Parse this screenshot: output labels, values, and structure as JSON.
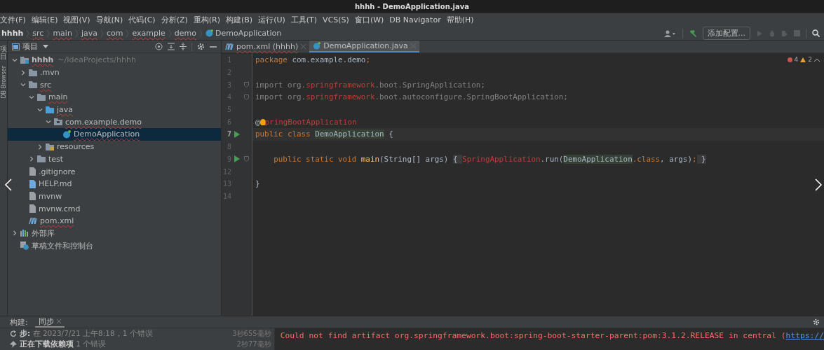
{
  "window": {
    "title": "hhhh - DemoApplication.java"
  },
  "menu": [
    "文件(F)",
    "编辑(E)",
    "视图(V)",
    "导航(N)",
    "代码(C)",
    "分析(Z)",
    "重构(R)",
    "构建(B)",
    "运行(U)",
    "工具(T)",
    "VCS(S)",
    "窗口(W)",
    "DB Navigator",
    "帮助(H)"
  ],
  "breadcrumbs": [
    {
      "label": "hhhh",
      "kind": "root",
      "error": false
    },
    {
      "label": "src",
      "kind": "plain",
      "error": true
    },
    {
      "label": "main",
      "kind": "plain",
      "error": true
    },
    {
      "label": "java",
      "kind": "plain",
      "error": true
    },
    {
      "label": "com",
      "kind": "plain",
      "error": true
    },
    {
      "label": "example",
      "kind": "plain",
      "error": true
    },
    {
      "label": "demo",
      "kind": "plain",
      "error": true
    },
    {
      "label": "DemoApplication",
      "kind": "class",
      "error": false
    }
  ],
  "toolbar": {
    "config_button": "添加配置...",
    "run_disabled": true
  },
  "side_stripe": {
    "project_tab": "项目",
    "db_tab": "DB Browser"
  },
  "project_panel": {
    "title": "项目",
    "tree": [
      {
        "label": "hhhh",
        "path": "~/IdeaProjects/hhhh",
        "kind": "module",
        "expanded": true,
        "selected": false,
        "error": true,
        "children": [
          {
            "label": ".mvn",
            "kind": "folder",
            "expanded": false,
            "selected": false,
            "error": false
          },
          {
            "label": "src",
            "kind": "folder",
            "expanded": true,
            "selected": false,
            "error": true,
            "children": [
              {
                "label": "main",
                "kind": "folder",
                "expanded": true,
                "selected": false,
                "error": true,
                "children": [
                  {
                    "label": "java",
                    "kind": "source",
                    "expanded": true,
                    "selected": false,
                    "error": true,
                    "children": [
                      {
                        "label": "com.example.demo",
                        "kind": "package",
                        "expanded": true,
                        "selected": false,
                        "error": true,
                        "children": [
                          {
                            "label": "DemoApplication",
                            "kind": "class",
                            "selected": true,
                            "error": true
                          }
                        ]
                      }
                    ]
                  },
                  {
                    "label": "resources",
                    "kind": "resources",
                    "expanded": false,
                    "selected": false,
                    "error": false
                  }
                ]
              },
              {
                "label": "test",
                "kind": "folder",
                "expanded": false,
                "selected": false,
                "error": false
              }
            ]
          },
          {
            "label": ".gitignore",
            "kind": "file",
            "selected": false,
            "error": false
          },
          {
            "label": "HELP.md",
            "kind": "markdown",
            "selected": false,
            "error": false
          },
          {
            "label": "mvnw",
            "kind": "script",
            "selected": false,
            "error": false
          },
          {
            "label": "mvnw.cmd",
            "kind": "file",
            "selected": false,
            "error": false
          },
          {
            "label": "pom.xml",
            "kind": "maven",
            "selected": false,
            "error": true
          }
        ]
      },
      {
        "label": "外部库",
        "kind": "library",
        "expanded": false,
        "selected": false,
        "error": false
      },
      {
        "label": "草稿文件和控制台",
        "kind": "scratch",
        "selected": false,
        "error": false
      }
    ]
  },
  "tabs": [
    {
      "label": "pom.xml (hhhh)",
      "kind": "maven",
      "selected": false,
      "error": true
    },
    {
      "label": "DemoApplication.java",
      "kind": "class",
      "selected": true,
      "error": false
    }
  ],
  "problems": {
    "errors": "4",
    "warnings": "2"
  },
  "code": [
    {
      "number": "1",
      "current": false,
      "run": false,
      "fold": false,
      "tokens": [
        {
          "text": "package ",
          "kind": "kw"
        },
        {
          "text": "com.example.demo",
          "kind": "plain"
        },
        {
          "text": ";",
          "kind": "kw"
        }
      ]
    },
    {
      "number": "2",
      "current": false,
      "run": false,
      "fold": false
    },
    {
      "number": "3",
      "current": false,
      "run": false,
      "fold": true,
      "tokens": [
        {
          "text": "import org.",
          "kind": "unused"
        },
        {
          "text": "springframework",
          "kind": "red"
        },
        {
          "text": ".boot.SpringApplication;",
          "kind": "unused"
        }
      ]
    },
    {
      "number": "4",
      "current": false,
      "run": false,
      "fold": true,
      "tokens": [
        {
          "text": "import org.",
          "kind": "unused"
        },
        {
          "text": "springframework",
          "kind": "red"
        },
        {
          "text": ".boot.autoconfigure.SpringBootApplication;",
          "kind": "unused"
        }
      ]
    },
    {
      "number": "5",
      "current": false,
      "run": false,
      "fold": false
    },
    {
      "number": "6",
      "current": false,
      "run": false,
      "fold": false,
      "tokens": [
        {
          "text": "@",
          "kind": "plain"
        },
        {
          "kind": "bulb"
        },
        {
          "text": "pringBootApplication",
          "kind": "red"
        }
      ]
    },
    {
      "number": "7",
      "current": true,
      "run": true,
      "fold": false,
      "tokens": [
        {
          "text": "public class ",
          "kind": "kw"
        },
        {
          "text": "DemoApplication",
          "kind": "hl"
        },
        {
          "text": " {",
          "kind": "plain"
        }
      ]
    },
    {
      "number": "8",
      "current": false,
      "run": false,
      "fold": false
    },
    {
      "number": "9",
      "current": false,
      "run": true,
      "fold": true,
      "tokens": [
        {
          "text": "    public static void ",
          "kind": "kw"
        },
        {
          "text": "main",
          "kind": "method"
        },
        {
          "text": "(String[] args) ",
          "kind": "plain"
        },
        {
          "text": "{ ",
          "kind": "folded"
        },
        {
          "text": "SpringApplication",
          "kind": "red"
        },
        {
          "text": ".run(",
          "kind": "plain"
        },
        {
          "text": "DemoApplication",
          "kind": "hl"
        },
        {
          "text": ".class",
          "kind": "kw"
        },
        {
          "text": ", args)",
          "kind": "plain"
        },
        {
          "text": ";",
          "kind": "kw"
        },
        {
          "text": " }",
          "kind": "folded"
        }
      ]
    },
    {
      "number": "12",
      "current": false,
      "run": false,
      "fold": false
    },
    {
      "number": "13",
      "current": false,
      "run": false,
      "fold": false,
      "tokens": [
        {
          "text": "}",
          "kind": "plain"
        }
      ]
    },
    {
      "number": "14",
      "current": false,
      "run": false,
      "fold": false
    }
  ],
  "build_panel": {
    "label": "构建:",
    "tabs": [
      {
        "label": "同步",
        "selected": true
      }
    ],
    "rows": [
      {
        "title": "步:",
        "text": " 在 2023/7/21 上午8:18，1 个错误",
        "time": "3秒655毫秒",
        "kind": "sync"
      },
      {
        "title": "正在下载依赖项",
        "text": " 1 个错误",
        "time": "2秒77毫秒",
        "kind": "download"
      }
    ],
    "log": "Could not find artifact org.springframework.boot:spring-boot-starter-parent:pom:3.1.2.RELEASE in central (",
    "log_link": "https://"
  }
}
